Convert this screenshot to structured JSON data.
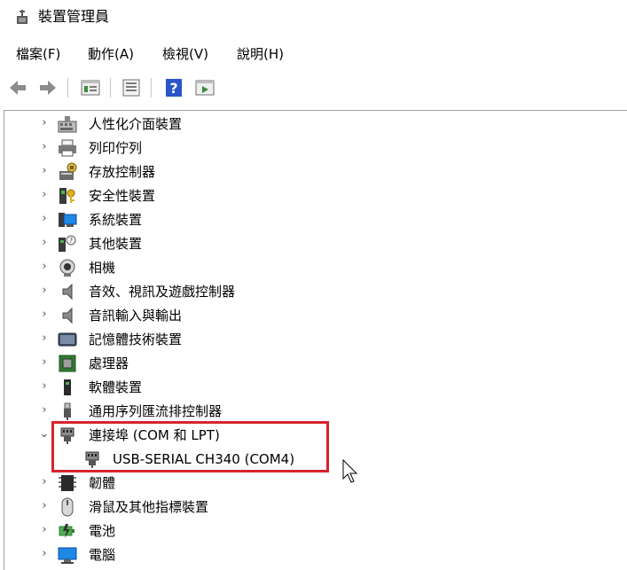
{
  "window": {
    "title": "裝置管理員"
  },
  "menu": [
    {
      "label": "檔案(F)"
    },
    {
      "label": "動作(A)"
    },
    {
      "label": "檢視(V)"
    },
    {
      "label": "說明(H)"
    }
  ],
  "toolbar": {
    "buttons": [
      "back-arrow-icon",
      "forward-arrow-icon",
      "properties-icon",
      "update-driver-icon",
      "help-icon",
      "run-icon"
    ]
  },
  "tree": {
    "nodes": [
      {
        "label": "人性化介面裝置",
        "expanded": false,
        "icon": "hid-icon"
      },
      {
        "label": "列印佇列",
        "expanded": false,
        "icon": "printer-icon"
      },
      {
        "label": "存放控制器",
        "expanded": false,
        "icon": "storage-controller-icon"
      },
      {
        "label": "安全性裝置",
        "expanded": false,
        "icon": "security-device-icon"
      },
      {
        "label": "系統裝置",
        "expanded": false,
        "icon": "system-device-icon"
      },
      {
        "label": "其他裝置",
        "expanded": false,
        "icon": "other-device-icon"
      },
      {
        "label": "相機",
        "expanded": false,
        "icon": "camera-icon"
      },
      {
        "label": "音效、視訊及遊戲控制器",
        "expanded": false,
        "icon": "speaker-icon"
      },
      {
        "label": "音訊輸入與輸出",
        "expanded": false,
        "icon": "speaker-icon"
      },
      {
        "label": "記憶體技術裝置",
        "expanded": false,
        "icon": "memory-icon"
      },
      {
        "label": "處理器",
        "expanded": false,
        "icon": "processor-icon"
      },
      {
        "label": "軟體裝置",
        "expanded": false,
        "icon": "software-device-icon"
      },
      {
        "label": "通用序列匯流排控制器",
        "expanded": false,
        "icon": "usb-icon"
      },
      {
        "label": "連接埠 (COM 和 LPT)",
        "expanded": true,
        "icon": "port-icon"
      },
      {
        "label": "USB-SERIAL CH340 (COM4)",
        "child": true,
        "icon": "port-icon"
      },
      {
        "label": "韌體",
        "expanded": false,
        "icon": "firmware-icon"
      },
      {
        "label": "滑鼠及其他指標裝置",
        "expanded": false,
        "icon": "mouse-icon"
      },
      {
        "label": "電池",
        "expanded": false,
        "icon": "battery-icon"
      },
      {
        "label": "電腦",
        "expanded": false,
        "icon": "computer-icon"
      }
    ]
  },
  "colors": {
    "highlight": "#d8232a",
    "help_icon_blue": "#2a55c9"
  }
}
